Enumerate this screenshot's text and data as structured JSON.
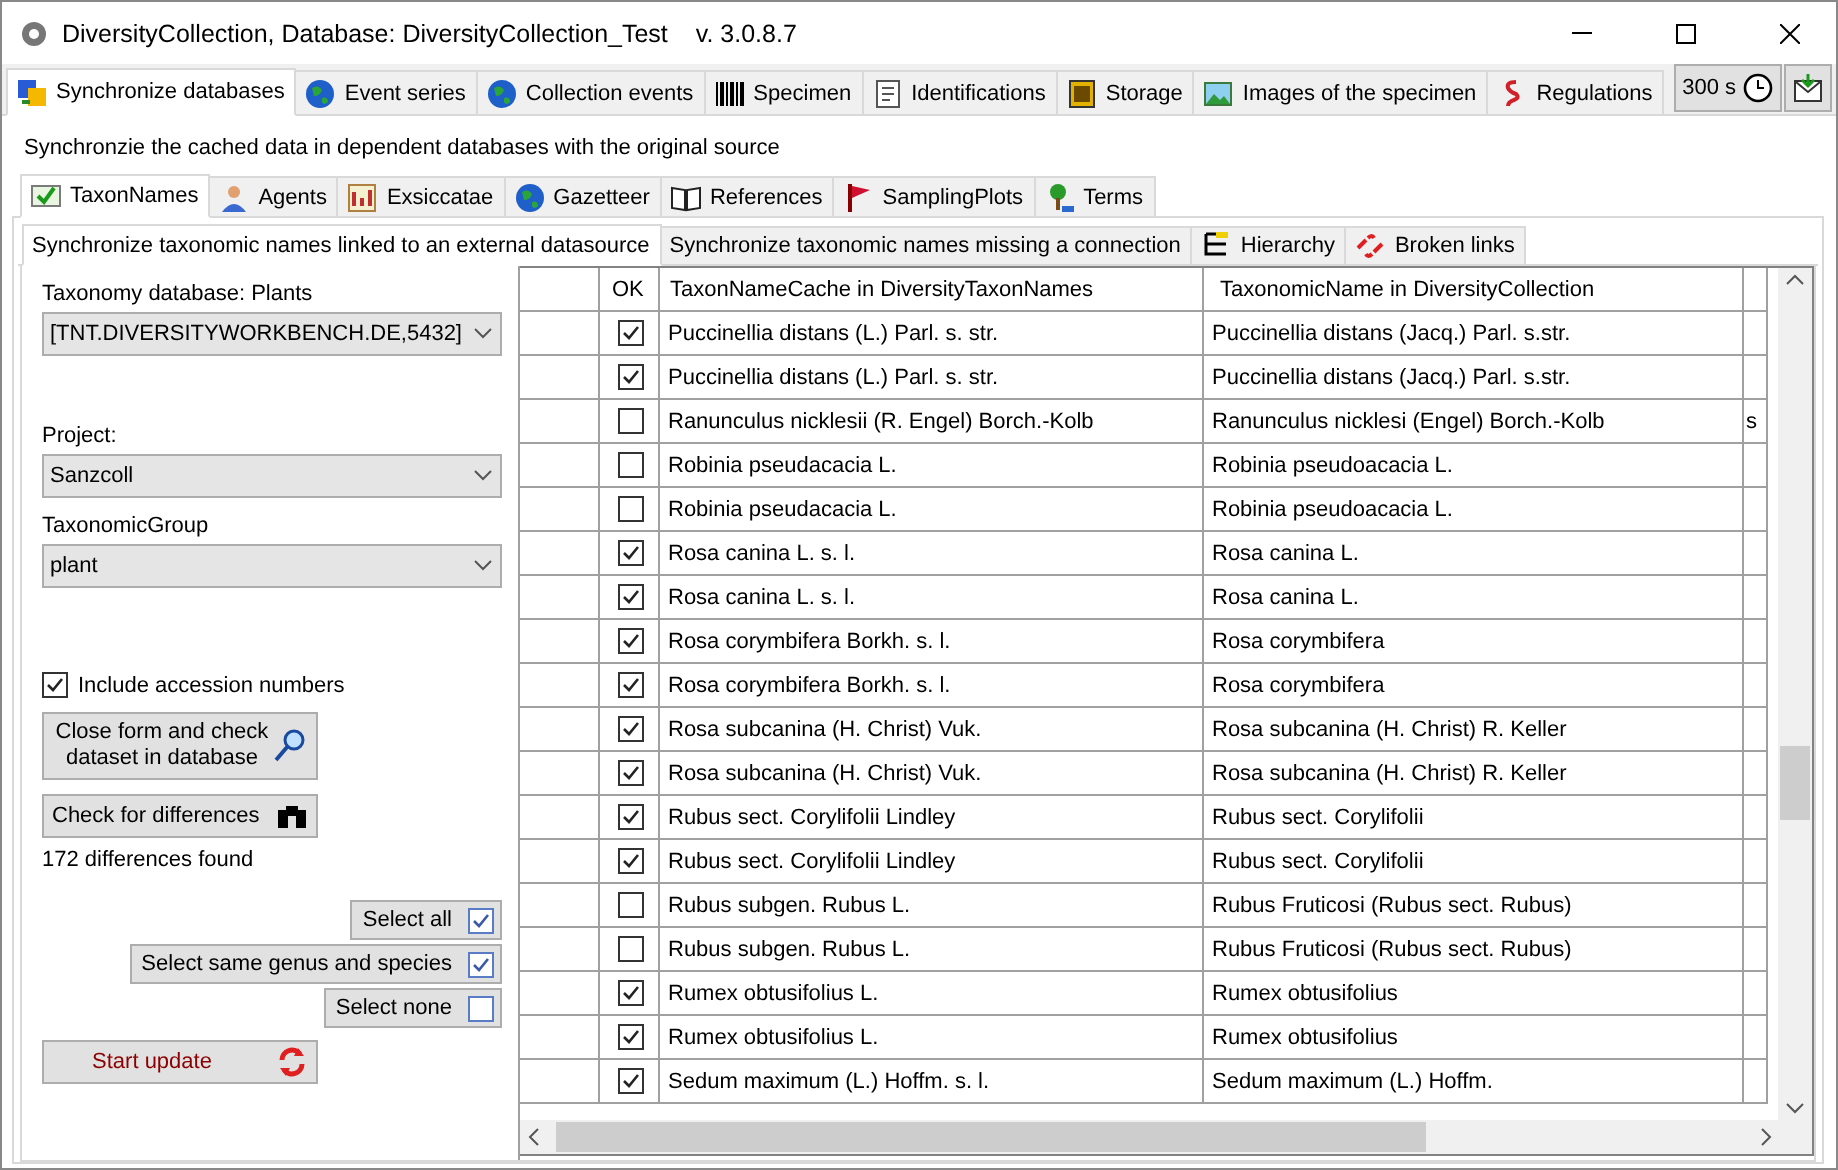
{
  "window": {
    "title": "DiversityCollection,  Database: DiversityCollection_Test",
    "version": "v. 3.0.8.7"
  },
  "main_tabs": [
    {
      "label": "Synchronize databases",
      "selected": true
    },
    {
      "label": "Event series",
      "selected": false
    },
    {
      "label": "Collection events",
      "selected": false
    },
    {
      "label": "Specimen",
      "selected": false
    },
    {
      "label": "Identifications",
      "selected": false
    },
    {
      "label": "Storage",
      "selected": false
    },
    {
      "label": "Images of the specimen",
      "selected": false
    },
    {
      "label": "Regulations",
      "selected": false
    }
  ],
  "timer_button": "300 s",
  "description": "Synchronzie the cached data in dependent databases with the original source",
  "sub_tabs": [
    {
      "label": "TaxonNames",
      "selected": true
    },
    {
      "label": "Agents",
      "selected": false
    },
    {
      "label": "Exsiccatae",
      "selected": false
    },
    {
      "label": "Gazetteer",
      "selected": false
    },
    {
      "label": "References",
      "selected": false
    },
    {
      "label": "SamplingPlots",
      "selected": false
    },
    {
      "label": "Terms",
      "selected": false
    }
  ],
  "task_tabs": [
    {
      "label": "Synchronize taxonomic names linked to an external datasource",
      "selected": true
    },
    {
      "label": "Synchronize taxonomic names missing a connection",
      "selected": false
    },
    {
      "label": "Hierarchy",
      "selected": false
    },
    {
      "label": "Broken links",
      "selected": false
    }
  ],
  "form": {
    "taxonomy_label": "Taxonomy database:  Plants",
    "taxonomy_value": "[TNT.DIVERSITYWORKBENCH.DE,5432]",
    "project_label": "Project:",
    "project_value": "Sanzcoll",
    "group_label": "TaxonomicGroup",
    "group_value": "plant",
    "include_accession": {
      "label": "Include accession numbers",
      "checked": true
    },
    "close_button": "Close form and check dataset in database",
    "check_button": "Check for differences",
    "result": "172 differences found",
    "select_buttons": [
      {
        "label": "Select all",
        "checked": true
      },
      {
        "label": "Select same genus and species",
        "checked": true
      },
      {
        "label": "Select none",
        "checked": false
      }
    ],
    "start_button": "Start update"
  },
  "table": {
    "columns": [
      "OK",
      "TaxonNameCache in DiversityTaxonNames",
      "TaxonomicName in DiversityCollection"
    ],
    "rows": [
      {
        "ok": true,
        "cache": "Puccinellia distans (L.) Parl. s. str.",
        "name": "Puccinellia distans (Jacq.) Parl. s.str."
      },
      {
        "ok": true,
        "cache": "Puccinellia distans (L.) Parl. s. str.",
        "name": "Puccinellia distans (Jacq.) Parl. s.str."
      },
      {
        "ok": false,
        "cache": "Ranunculus nicklesii (R. Engel) Borch.-Kolb",
        "name": "Ranunculus nicklesi (Engel) Borch.-Kolb",
        "column_4": "s"
      },
      {
        "ok": false,
        "cache": "Robinia pseudacacia L.",
        "name": "Robinia pseudoacacia L."
      },
      {
        "ok": false,
        "cache": "Robinia pseudacacia L.",
        "name": "Robinia pseudoacacia L."
      },
      {
        "ok": true,
        "cache": "Rosa canina L. s. l.",
        "name": "Rosa canina L."
      },
      {
        "ok": true,
        "cache": "Rosa canina L. s. l.",
        "name": "Rosa canina L."
      },
      {
        "ok": true,
        "cache": "Rosa corymbifera Borkh. s. l.",
        "name": "Rosa corymbifera"
      },
      {
        "ok": true,
        "cache": "Rosa corymbifera Borkh. s. l.",
        "name": "Rosa corymbifera"
      },
      {
        "ok": true,
        "cache": "Rosa subcanina (H. Christ) Vuk.",
        "name": "Rosa subcanina (H. Christ) R. Keller"
      },
      {
        "ok": true,
        "cache": "Rosa subcanina (H. Christ) Vuk.",
        "name": "Rosa subcanina (H. Christ) R. Keller"
      },
      {
        "ok": true,
        "cache": "Rubus sect. Corylifolii Lindley",
        "name": "Rubus sect. Corylifolii"
      },
      {
        "ok": true,
        "cache": "Rubus sect. Corylifolii Lindley",
        "name": "Rubus sect. Corylifolii"
      },
      {
        "ok": false,
        "cache": "Rubus subgen. Rubus L.",
        "name": "Rubus Fruticosi (Rubus sect. Rubus)"
      },
      {
        "ok": false,
        "cache": "Rubus subgen. Rubus L.",
        "name": "Rubus Fruticosi (Rubus sect. Rubus)"
      },
      {
        "ok": true,
        "cache": "Rumex obtusifolius L.",
        "name": "Rumex obtusifolius"
      },
      {
        "ok": true,
        "cache": "Rumex obtusifolius L.",
        "name": "Rumex obtusifolius"
      },
      {
        "ok": true,
        "cache": "Sedum maximum (L.) Hoffm. s. l.",
        "name": "Sedum maximum (L.) Hoffm."
      }
    ]
  }
}
